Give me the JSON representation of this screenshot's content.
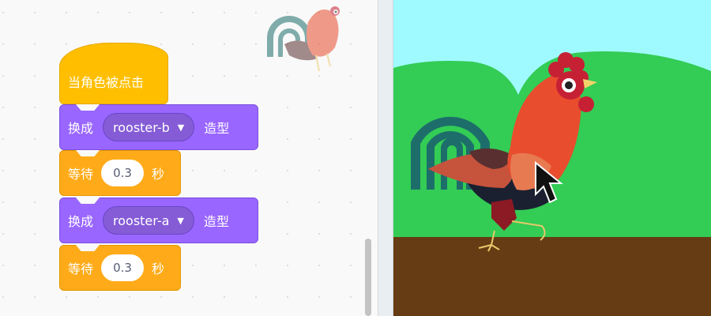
{
  "code_area": {
    "hat_block": {
      "label": "当角色被点击"
    },
    "blocks": [
      {
        "type": "looks",
        "prefix": "换成",
        "costume": "rooster-b",
        "suffix": "造型"
      },
      {
        "type": "wait",
        "prefix": "等待",
        "value": "0.3",
        "suffix": "秒"
      },
      {
        "type": "looks",
        "prefix": "换成",
        "costume": "rooster-a",
        "suffix": "造型"
      },
      {
        "type": "wait",
        "prefix": "等待",
        "value": "0.3",
        "suffix": "秒"
      }
    ],
    "dropdown_arrow": "▼"
  },
  "colors": {
    "events": "#ffbf00",
    "looks": "#9966ff",
    "control": "#ffab19",
    "sky": "#9ffaff",
    "hills": "#33cc55",
    "ground": "#663c14"
  },
  "icons": [
    "rooster-sprite-watermark",
    "mouse-cursor-icon"
  ]
}
